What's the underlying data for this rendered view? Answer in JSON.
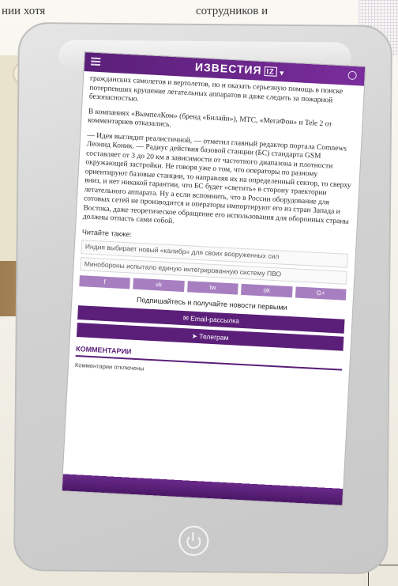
{
  "background": {
    "top_text_left": "нии хотя",
    "top_text_right": "сотрудников и"
  },
  "header": {
    "brand": "ИЗВЕСТИЯ",
    "brand_badge": "IZ"
  },
  "article": {
    "paragraphs": [
      "гражданских самолетов и вертолетов, но и оказать серьезную помощь в поиске потерпевших крушение летательных аппаратов и даже следить за пожарной безопасностью.",
      "В компаниях «ВымпелКом» (бренд «Билайн»), МТС, «МегаФон» и Tele 2 от комментариев отказались.",
      "— Идея выглядит реалистичной, — отметил главный редактор портала Comnews Леонид Коник. — Радиус действия базовой станции (БС) стандарта GSM составляет от 3 до 20 км в зависимости от частотного диапазона и плотности окружающей застройки. Не говоря уже о том, что операторы по разному ориентируют базовые станции, то направляя их на определенный сектор, то сверху вниз, и нет никакой гарантии, что БС будет «светить» в сторону траектории летательного аппарата. Ну а если вспомнить, что в России оборудование для сотовых сетей не производится и операторы импортируют его из стран Запада и Востока, даже теоретическое обращение его использования для оборонных страны должны отпасть сами собой."
    ],
    "read_also": "Читайте также:",
    "related_links": [
      "Индия выбирает новый «калибр» для своих вооруженных сил",
      "Минобороны испытало единую интегрированную систему ПВО"
    ]
  },
  "share": {
    "buttons": [
      "f",
      "vk",
      "tw",
      "ok",
      "G+"
    ]
  },
  "subscribe": {
    "title": "Подпишайтесь и получайте новости первыми",
    "email_label": "Email-рассылка",
    "telegram_label": "Телеграм"
  },
  "comments": {
    "title": "КОММЕНТАРИИ",
    "closed_text": "Комментарии отключены"
  }
}
